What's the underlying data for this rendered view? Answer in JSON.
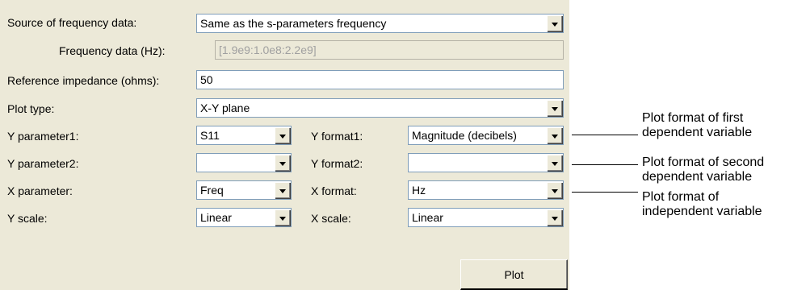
{
  "source": {
    "label": "Source of frequency data:",
    "value": "Same as the s-parameters frequency"
  },
  "frequency": {
    "label": "Frequency data (Hz):",
    "value": "[1.9e9:1.0e8:2.2e9]"
  },
  "impedance": {
    "label": "Reference impedance (ohms):",
    "value": "50"
  },
  "plot_type": {
    "label": "Plot type:",
    "value": "X-Y plane"
  },
  "y_param1": {
    "label": "Y parameter1:",
    "value": "S11"
  },
  "y_format1": {
    "label": "Y format1:",
    "value": "Magnitude (decibels)"
  },
  "y_param2": {
    "label": "Y parameter2:",
    "value": ""
  },
  "y_format2": {
    "label": "Y format2:",
    "value": ""
  },
  "x_param": {
    "label": "X parameter:",
    "value": "Freq"
  },
  "x_format": {
    "label": "X format:",
    "value": "Hz"
  },
  "y_scale": {
    "label": "Y scale:",
    "value": "Linear"
  },
  "x_scale": {
    "label": "X scale:",
    "value": "Linear"
  },
  "plot_button": "Plot",
  "annotations": {
    "first_line1": "Plot format of first",
    "first_line2": "dependent variable",
    "second_line1": "Plot format of second",
    "second_line2": "dependent variable",
    "indep_line1": "Plot format of",
    "indep_line2": "independent variable"
  }
}
